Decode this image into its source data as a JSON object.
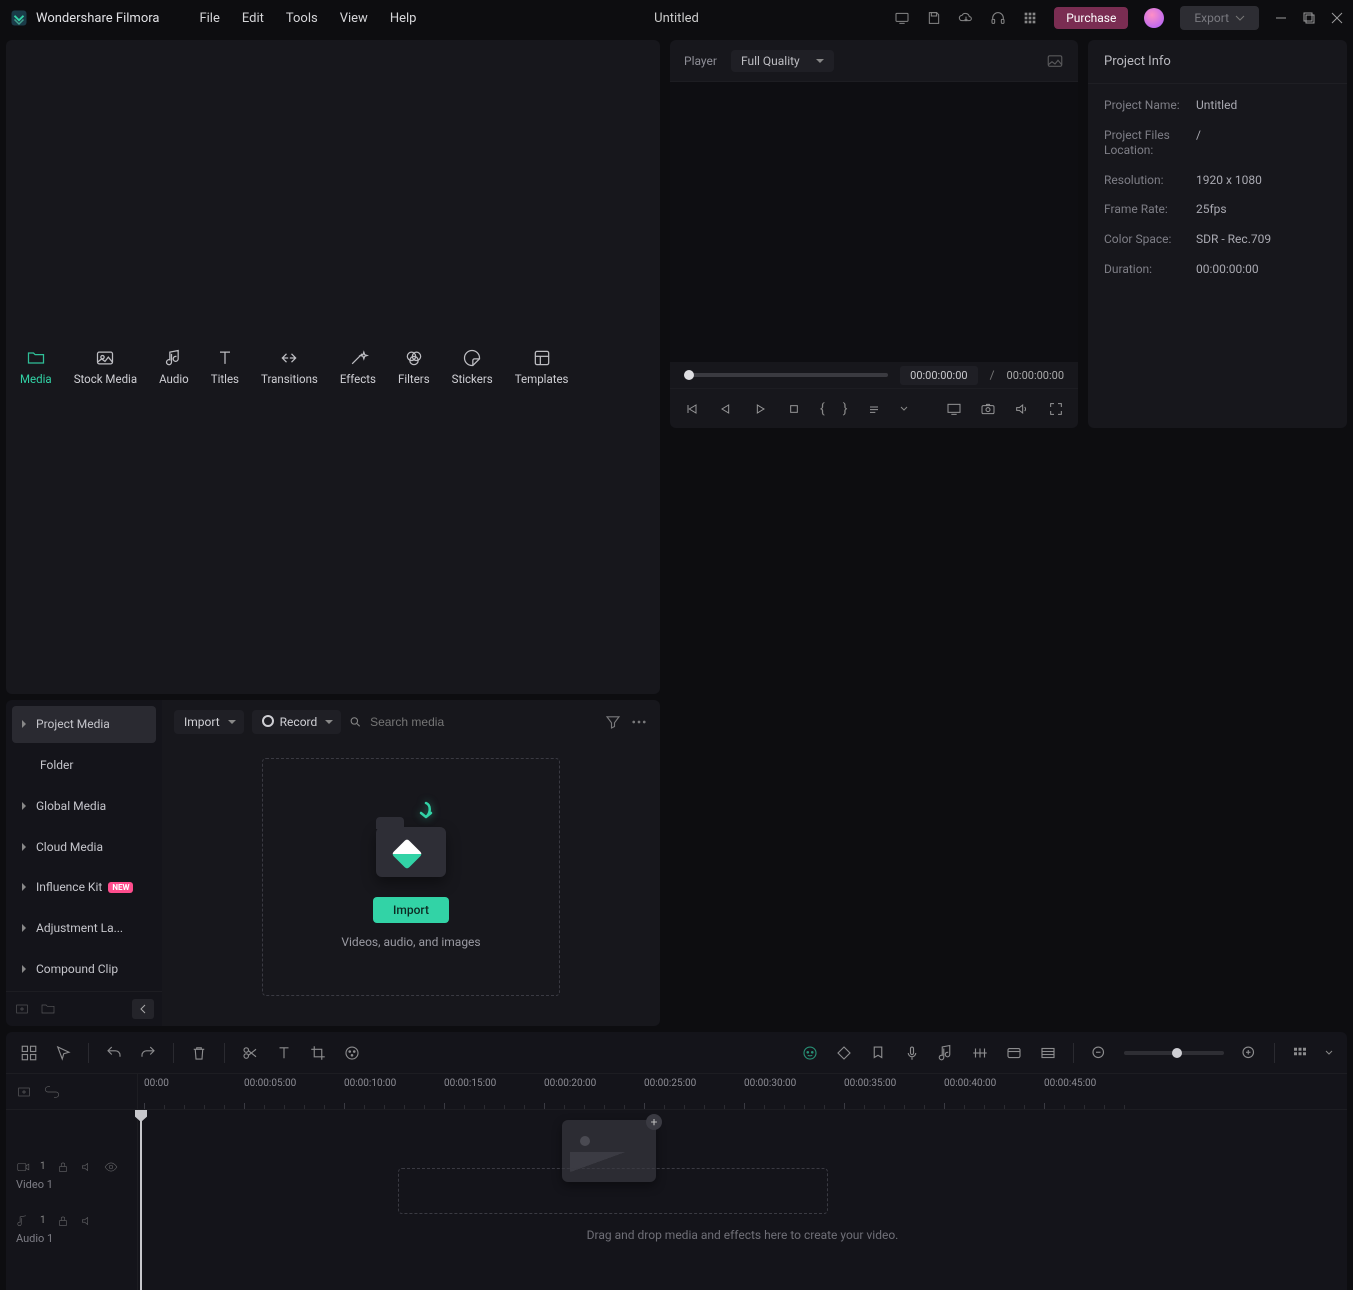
{
  "app": {
    "name": "Wondershare Filmora",
    "document": "Untitled"
  },
  "menu": {
    "file": "File",
    "edit": "Edit",
    "tools": "Tools",
    "view": "View",
    "help": "Help"
  },
  "titlebar": {
    "purchase": "Purchase",
    "export": "Export"
  },
  "tabs": {
    "media": "Media",
    "stock": "Stock Media",
    "audio": "Audio",
    "titles": "Titles",
    "transitions": "Transitions",
    "effects": "Effects",
    "filters": "Filters",
    "stickers": "Stickers",
    "templates": "Templates"
  },
  "media": {
    "tree": {
      "project": "Project Media",
      "folder": "Folder",
      "global": "Global Media",
      "cloud": "Cloud Media",
      "influence": "Influence Kit",
      "influence_badge": "NEW",
      "adjustment": "Adjustment La...",
      "compound": "Compound Clip"
    },
    "bar": {
      "import": "Import",
      "record": "Record",
      "search_placeholder": "Search media"
    },
    "drop": {
      "import_btn": "Import",
      "sub": "Videos, audio, and images"
    }
  },
  "player": {
    "label": "Player",
    "quality": "Full Quality",
    "time_current": "00:00:00:00",
    "time_total": "00:00:00:00",
    "slash": "/"
  },
  "project": {
    "head": "Project Info",
    "name_label": "Project Name:",
    "name_val": "Untitled",
    "loc_label": "Project Files Location:",
    "loc_val": "/",
    "res_label": "Resolution:",
    "res_val": "1920 x 1080",
    "fps_label": "Frame Rate:",
    "fps_val": "25fps",
    "cs_label": "Color Space:",
    "cs_val": "SDR - Rec.709",
    "dur_label": "Duration:",
    "dur_val": "00:00:00:00"
  },
  "timeline": {
    "ruler": [
      "00:00",
      "00:00:05:00",
      "00:00:10:00",
      "00:00:15:00",
      "00:00:20:00",
      "00:00:25:00",
      "00:00:30:00",
      "00:00:35:00",
      "00:00:40:00",
      "00:00:45:00"
    ],
    "tracks": {
      "video": "Video 1",
      "audio": "Audio 1"
    },
    "drop_text": "Drag and drop media and effects here to create your video."
  }
}
